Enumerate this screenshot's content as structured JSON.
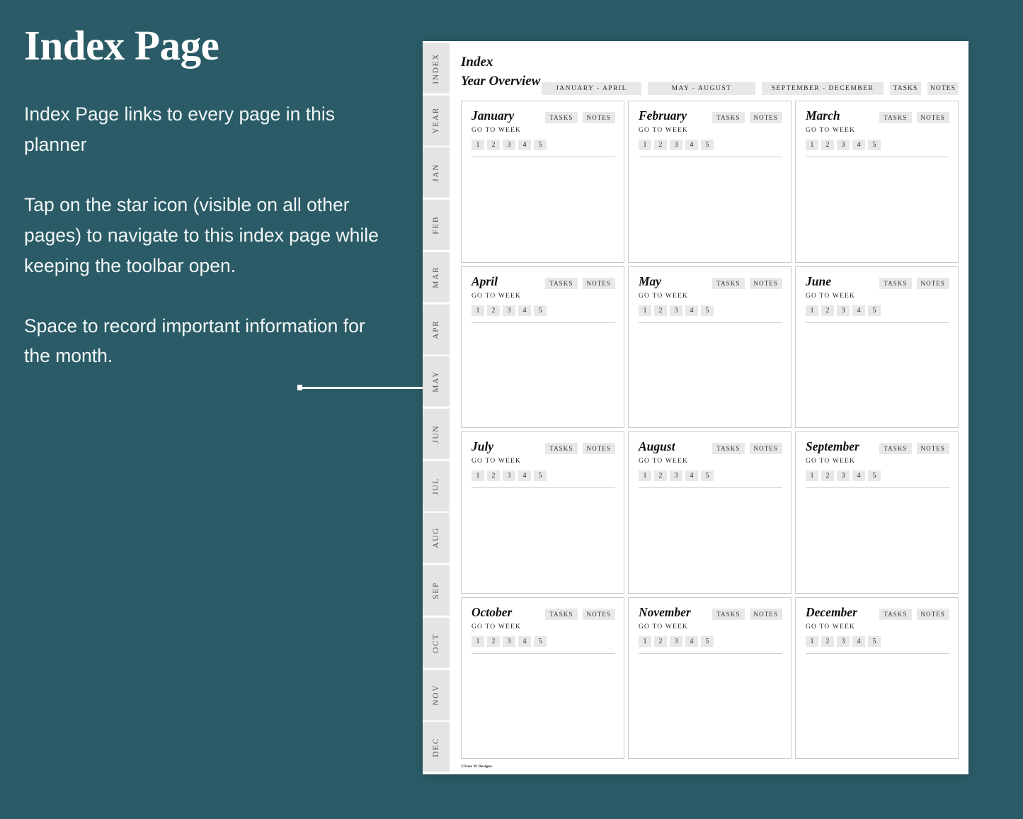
{
  "colors": {
    "background_teal": "#2a5b66",
    "paper_white": "#ffffff",
    "chip_gray": "#e8e8e8",
    "tab_gray": "#e4e4e4",
    "border_gray": "#c9c9c9",
    "text_dark": "#121212"
  },
  "annotation": {
    "title": "Index Page",
    "paragraphs": [
      "Index Page links to every page in this planner",
      "Tap on the star icon (visible on all other pages) to navigate to this index page while keeping the toolbar open.",
      "Space to record important information for the month."
    ]
  },
  "planner": {
    "side_tabs": [
      "INDEX",
      "YEAR",
      "JAN",
      "FEB",
      "MAR",
      "APR",
      "MAY",
      "JUN",
      "JUL",
      "AUG",
      "SEP",
      "OCT",
      "NOV",
      "DEC"
    ],
    "header": {
      "title": "Index",
      "subtitle": "Year Overview",
      "tabs": [
        {
          "label": "JANUARY - APRIL",
          "size": "wide-1"
        },
        {
          "label": "MAY - AUGUST",
          "size": "wide-2"
        },
        {
          "label": "SEPTEMBER - DECEMBER",
          "size": "wide-3"
        },
        {
          "label": "TASKS",
          "size": "small"
        },
        {
          "label": "NOTES",
          "size": "small"
        }
      ]
    },
    "card_labels": {
      "tasks": "TASKS",
      "notes": "NOTES",
      "go_to_week": "GO TO WEEK",
      "weeks": [
        "1",
        "2",
        "3",
        "4",
        "5"
      ]
    },
    "months": [
      "January",
      "February",
      "March",
      "April",
      "May",
      "June",
      "July",
      "August",
      "September",
      "October",
      "November",
      "December"
    ],
    "footer": "©Jena W Designs"
  }
}
